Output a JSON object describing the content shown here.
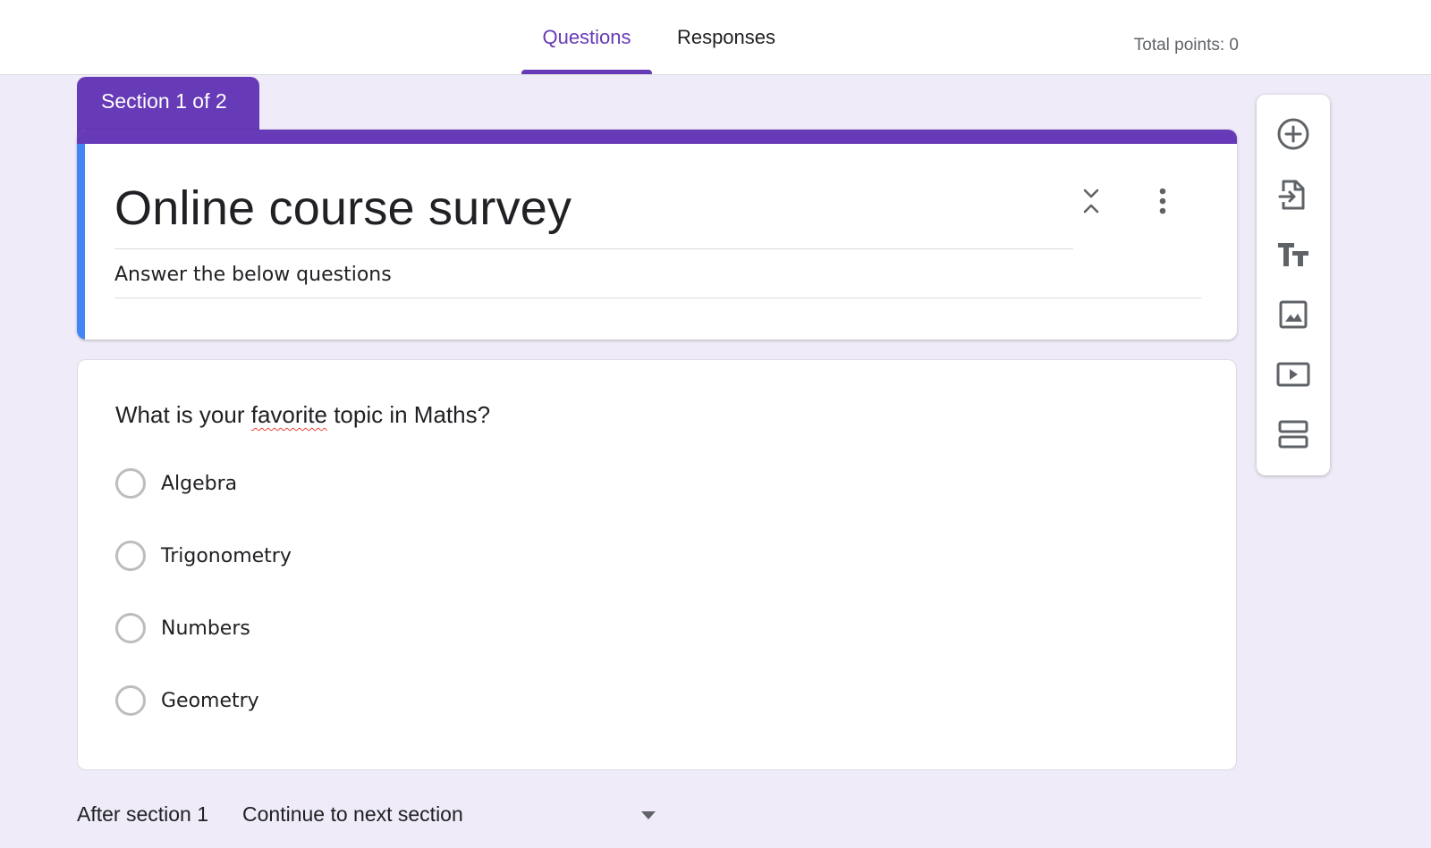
{
  "tabs": {
    "questions": "Questions",
    "responses": "Responses",
    "active": "Questions"
  },
  "total_points": "Total points: 0",
  "section_tab": "Section 1 of 2",
  "form": {
    "title": "Online course survey",
    "description": "Answer the below questions"
  },
  "question": {
    "title_before": "What is your ",
    "title_misspelled": "favorite",
    "title_after": " topic in Maths?",
    "options": [
      "Algebra",
      "Trigonometry",
      "Numbers",
      "Geometry"
    ]
  },
  "side_toolbar": {
    "icons": [
      "add-question-icon",
      "import-questions-icon",
      "add-title-icon",
      "add-image-icon",
      "add-video-icon",
      "add-section-icon"
    ]
  },
  "after_section": {
    "label": "After section 1",
    "value": "Continue to next section"
  },
  "colors": {
    "accent": "#673ab7",
    "header_left_band": "#4285f4",
    "background": "#efebf8"
  }
}
